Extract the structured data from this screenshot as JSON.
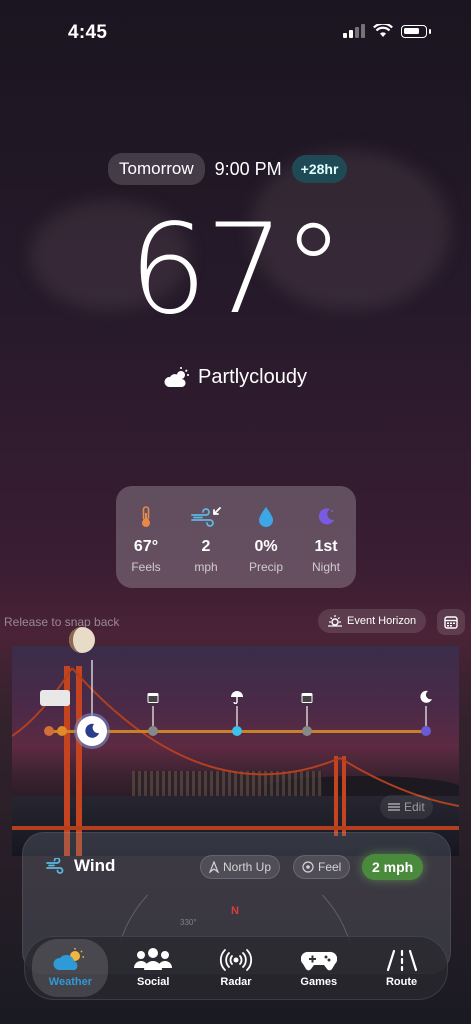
{
  "status_bar": {
    "time": "4:45"
  },
  "forecast": {
    "day": "Tomorrow",
    "time": "9:00 PM",
    "offset": "+28hr",
    "temperature": "67°",
    "condition": "Partlycloudy"
  },
  "stats": [
    {
      "icon": "thermometer-icon",
      "value": "67°",
      "label": "Feels"
    },
    {
      "icon": "wind-icon",
      "value": "2",
      "label": "mph"
    },
    {
      "icon": "droplet-icon",
      "value": "0%",
      "label": "Precip"
    },
    {
      "icon": "moon-icon",
      "value": "1st",
      "label": "Night"
    }
  ],
  "timeline": {
    "hint": "Release to snap back",
    "event_button": "Event Horizon",
    "edit_label": "Edit"
  },
  "wind": {
    "title": "Wind",
    "north_up": "North Up",
    "feel": "Feel",
    "speed": "2 mph",
    "compass_label": "N",
    "dial_tick": "330°"
  },
  "tabs": [
    {
      "label": "Weather",
      "icon": "cloud-sun-icon",
      "active": true
    },
    {
      "label": "Social",
      "icon": "people-icon",
      "active": false
    },
    {
      "label": "Radar",
      "icon": "radar-icon",
      "active": false
    },
    {
      "label": "Games",
      "icon": "gamepad-icon",
      "active": false
    },
    {
      "label": "Route",
      "icon": "road-icon",
      "active": false
    }
  ],
  "colors": {
    "accent_teal": "#1f4a55",
    "timeline": "#c8832a",
    "wind_speed": "#4a8a3d",
    "active_tab": "#2e9bd6"
  }
}
